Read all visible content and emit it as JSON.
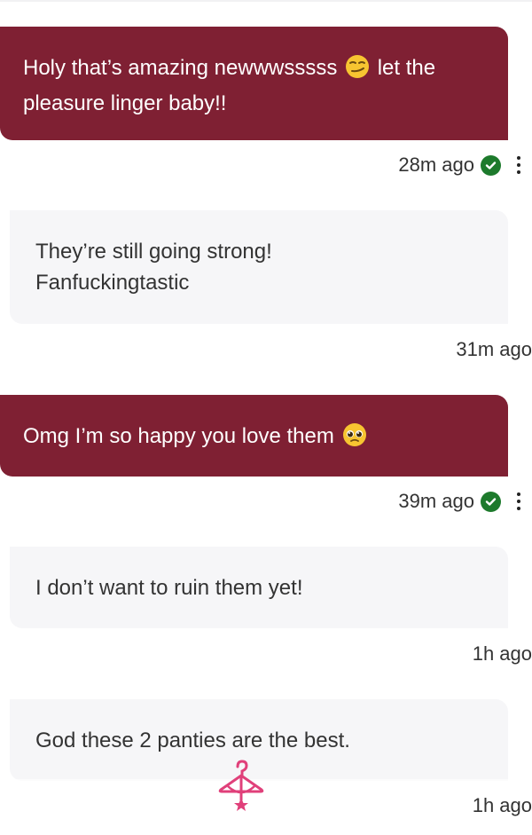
{
  "messages": [
    {
      "text": "Holy that’s amazing newwwsssss",
      "text_after_emoji": "let the pleasure linger baby!!",
      "emoji": "smirk-emoji",
      "time": "28m ago",
      "direction": "sent"
    },
    {
      "text": "They’re still going strong! Fanfuckingtastic",
      "time": "31m ago",
      "direction": "received"
    },
    {
      "text": "Omg I’m so happy you love them",
      "emoji": "pleading-face-emoji",
      "time": "39m ago",
      "direction": "sent"
    },
    {
      "text": "I don’t want to ruin them yet!",
      "time": "1h ago",
      "direction": "received"
    },
    {
      "text": "God these 2 panties are the best.",
      "time": "1h ago",
      "direction": "received"
    }
  ],
  "icons": {
    "read_receipt": "check-circle-icon",
    "options": "kebab-menu-icon",
    "watermark": "hanger-logo-icon"
  },
  "colors": {
    "sent_bubble": "#7f2033",
    "received_bubble": "#f6f6f8",
    "read_check": "#1d7a2c",
    "logo": "#e0407a"
  }
}
